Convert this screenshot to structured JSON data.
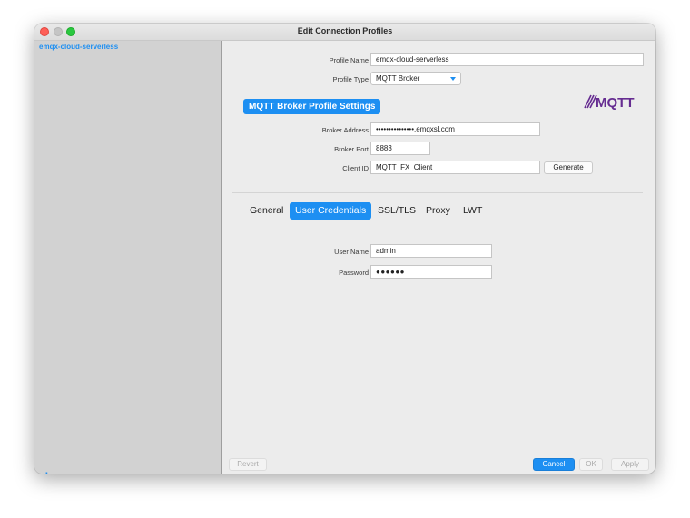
{
  "window": {
    "title": "Edit Connection Profiles"
  },
  "sidebar": {
    "items": [
      {
        "label": "emqx-cloud-serverless"
      }
    ],
    "add_label": "+",
    "remove_label": "−"
  },
  "profile": {
    "name_label": "Profile Name",
    "name_value": "emqx-cloud-serverless",
    "type_label": "Profile Type",
    "type_value": "MQTT Broker",
    "logo_text": "MQTT"
  },
  "broker": {
    "section_title": "MQTT Broker Profile Settings",
    "address_label": "Broker Address",
    "address_value": "•••••••••••••••.emqxsl.com",
    "port_label": "Broker Port",
    "port_value": "8883",
    "client_id_label": "Client ID",
    "client_id_value": "MQTT_FX_Client",
    "generate_label": "Generate"
  },
  "tabs": [
    {
      "label": "General",
      "active": false
    },
    {
      "label": "User Credentials",
      "active": true
    },
    {
      "label": "SSL/TLS",
      "active": false
    },
    {
      "label": "Proxy",
      "active": false
    },
    {
      "label": "LWT",
      "active": false
    }
  ],
  "credentials": {
    "username_label": "User Name",
    "username_value": "admin",
    "password_label": "Password",
    "password_value": "●●●●●●"
  },
  "footer": {
    "revert_label": "Revert",
    "cancel_label": "Cancel",
    "ok_label": "OK",
    "apply_label": "Apply"
  },
  "colors": {
    "accent": "#1d8ff2",
    "logo_purple": "#662d91"
  }
}
